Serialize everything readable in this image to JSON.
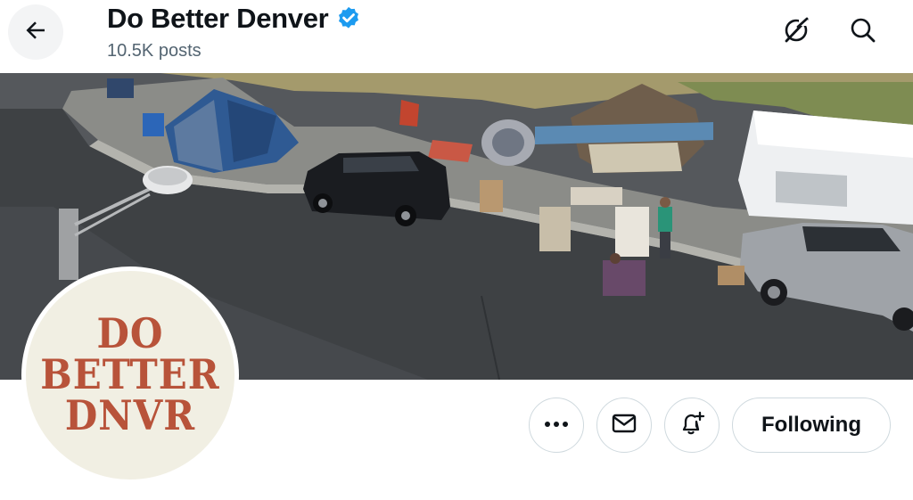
{
  "header": {
    "profile_name": "Do Better Denver",
    "post_count": "10.5K posts",
    "verified": true
  },
  "icons": {
    "back": "back-arrow-icon",
    "verified": "verified-badge-icon",
    "grok": "grok-icon",
    "search": "search-icon",
    "more": "more-icon",
    "message": "mail-icon",
    "notify": "bell-plus-icon"
  },
  "avatar": {
    "logo_lines": [
      "DO",
      "BETTER",
      "DNVR"
    ]
  },
  "actions": {
    "following_label": "Following"
  },
  "colors": {
    "verified_blue": "#1d9bf0",
    "logo_rust": "#b8533a",
    "logo_bg": "#f1efe3",
    "muted_text": "#536471",
    "button_border": "#cfd9de"
  }
}
